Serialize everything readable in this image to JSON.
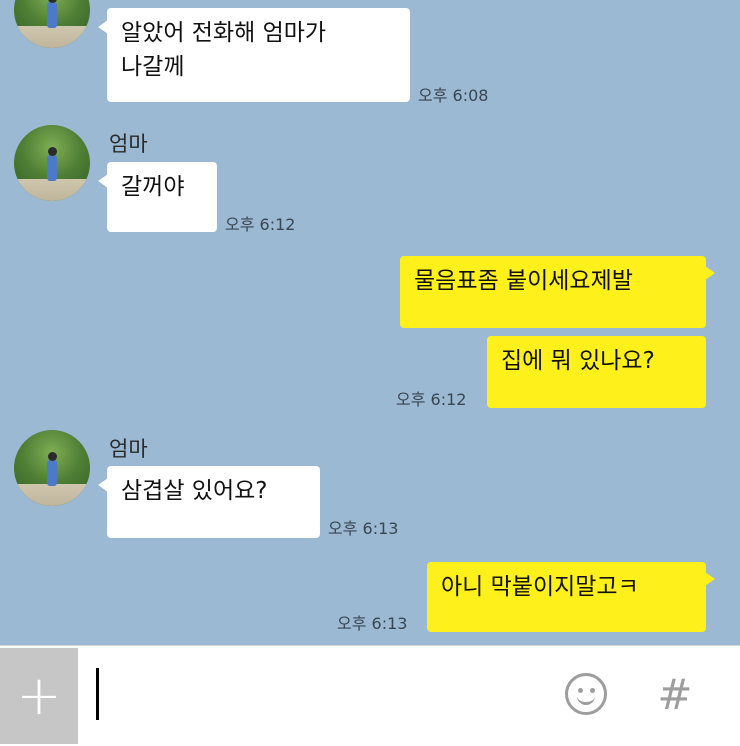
{
  "messages": [
    {
      "direction": "in",
      "show_avatar": false,
      "text": "알았어  전화해  엄마가\n나갈께",
      "time": "오후 6:08"
    },
    {
      "direction": "in",
      "show_avatar": true,
      "sender": "엄마",
      "text": "갈꺼야",
      "time": "오후 6:12"
    },
    {
      "direction": "out",
      "text": "물음표좀 붙이세요제발",
      "time": ""
    },
    {
      "direction": "out",
      "text": "집에 뭐 있나요?",
      "time": "오후 6:12"
    },
    {
      "direction": "in",
      "show_avatar": true,
      "sender": "엄마",
      "text": "삼겹살 있어요?",
      "time": "오후 6:13"
    },
    {
      "direction": "out",
      "text": "아니 막붙이지말고ㅋ",
      "time": "오후 6:13"
    }
  ],
  "input_bar": {
    "plus_label": "+",
    "message_value": "",
    "hash_label": "#",
    "emoji_icon": "smiley-icon"
  },
  "colors": {
    "chat_background": "#9bb9d3",
    "incoming_bubble": "#ffffff",
    "outgoing_bubble": "#fef01b"
  }
}
